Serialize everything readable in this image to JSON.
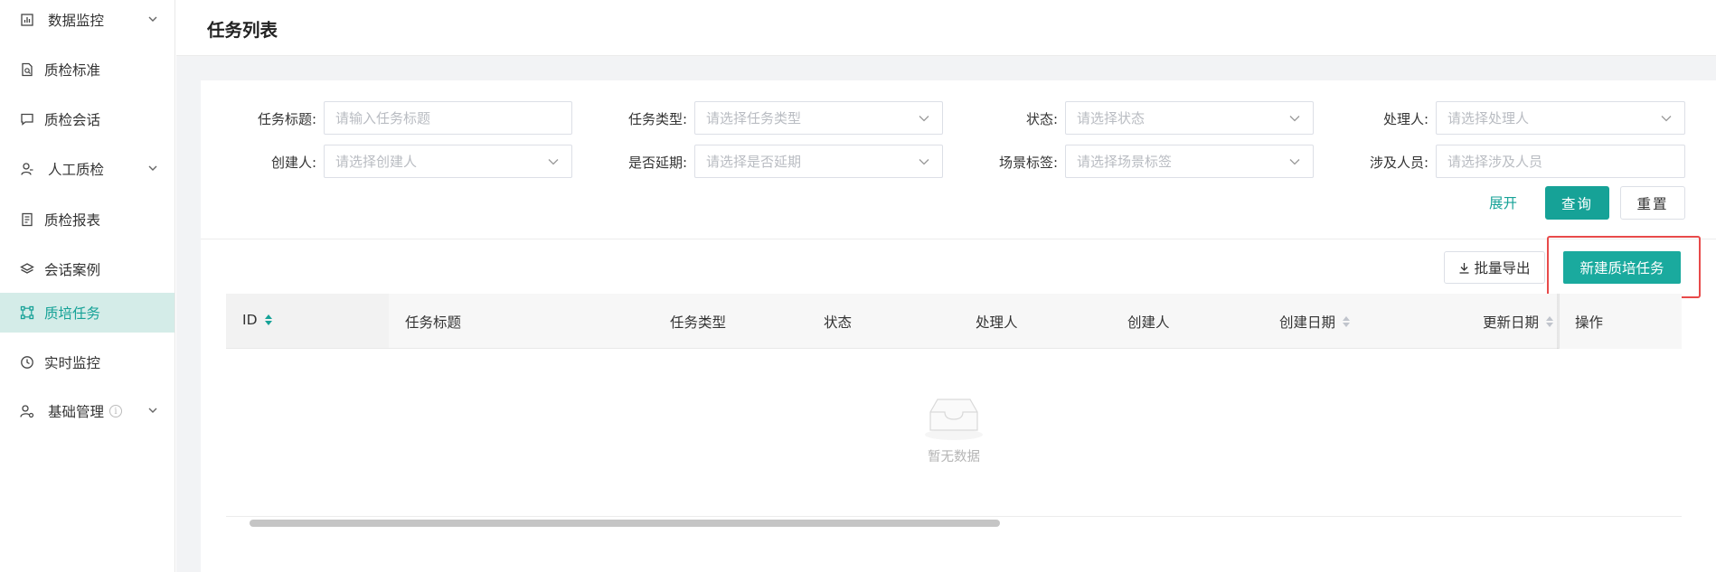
{
  "sidebar": {
    "items": [
      {
        "label": "数据监控",
        "icon": "chart-bar-icon",
        "has_chevron": true
      },
      {
        "label": "质检标准",
        "icon": "document-search-icon",
        "has_chevron": false
      },
      {
        "label": "质检会话",
        "icon": "chat-bubble-icon",
        "has_chevron": false
      },
      {
        "label": "人工质检",
        "icon": "user-icon",
        "has_chevron": true
      },
      {
        "label": "质检报表",
        "icon": "report-icon",
        "has_chevron": false
      },
      {
        "label": "会话案例",
        "icon": "layers-icon",
        "has_chevron": false
      },
      {
        "label": "质培任务",
        "icon": "nodes-icon",
        "has_chevron": false,
        "active": true
      },
      {
        "label": "实时监控",
        "icon": "clock-icon",
        "has_chevron": false
      },
      {
        "label": "基础管理",
        "icon": "user-gear-icon",
        "has_chevron": true,
        "info_glyph": "i"
      }
    ]
  },
  "header": {
    "title": "任务列表"
  },
  "filters": {
    "task_title": {
      "label": "任务标题:",
      "placeholder": "请输入任务标题"
    },
    "task_type": {
      "label": "任务类型:",
      "placeholder": "请选择任务类型"
    },
    "status": {
      "label": "状态:",
      "placeholder": "请选择状态"
    },
    "handler": {
      "label": "处理人:",
      "placeholder": "请选择处理人"
    },
    "creator": {
      "label": "创建人:",
      "placeholder": "请选择创建人"
    },
    "is_delayed": {
      "label": "是否延期:",
      "placeholder": "请选择是否延期"
    },
    "scene_tag": {
      "label": "场景标签:",
      "placeholder": "请选择场景标签"
    },
    "involved": {
      "label": "涉及人员:",
      "placeholder": "请选择涉及人员"
    },
    "expand_label": "展开",
    "query_label": "查询",
    "reset_label": "重置"
  },
  "toolbar": {
    "export_label": "批量导出",
    "new_task_label": "新建质培任务"
  },
  "table": {
    "columns": {
      "id": "ID",
      "title": "任务标题",
      "type": "任务类型",
      "status": "状态",
      "handler": "处理人",
      "creator": "创建人",
      "created_date": "创建日期",
      "updated_date": "更新日期",
      "actions": "操作"
    },
    "empty_text": "暂无数据"
  },
  "colors": {
    "accent": "#16a297",
    "highlight_box": "#e84a4a",
    "active_bg": "#d4ece8"
  }
}
